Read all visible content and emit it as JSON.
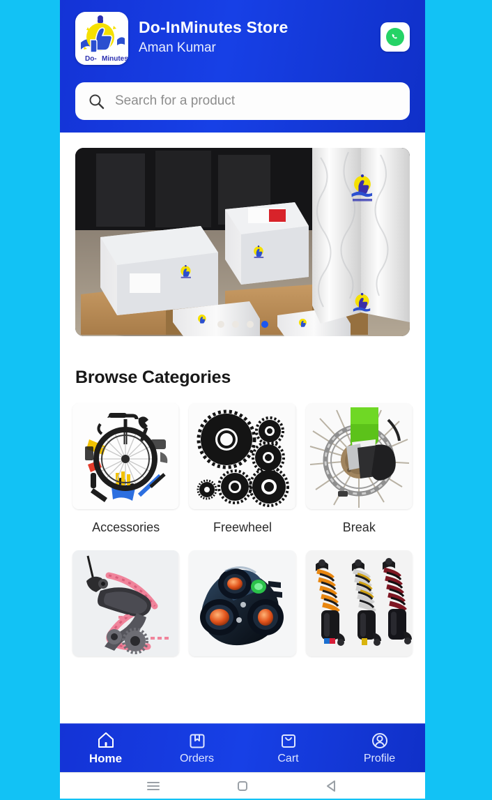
{
  "theme": {
    "outer_bg": "#12c2f5",
    "header_blue": "#1740e6",
    "accent_blue": "#1a56f0",
    "whatsapp_green": "#25D366",
    "logo_yellow": "#f5e000",
    "logo_blue": "#2b2fb0"
  },
  "header": {
    "logo": {
      "icon": "do-inminutes-logo",
      "caption_left": "Do-",
      "caption_right": "Minutes"
    },
    "store_name": "Do-InMinutes Store",
    "owner_name": "Aman Kumar",
    "whatsapp_icon": "whatsapp-icon"
  },
  "search": {
    "icon": "search-icon",
    "placeholder": "Search for a product",
    "value": ""
  },
  "carousel": {
    "alt": "Packed shipment boxes and wrapped bundles with Do-InMinutes logo stickers",
    "slide_count": 4,
    "active_index": 3
  },
  "sections": {
    "browse_categories_title": "Browse Categories"
  },
  "categories": [
    {
      "label": "Accessories",
      "image": "bicycle-wheel-with-tools-image"
    },
    {
      "label": "Freewheel",
      "image": "cassette-sprockets-image"
    },
    {
      "label": "Break",
      "image": "disc-brake-rotor-image"
    },
    {
      "label": "",
      "image": "rear-derailleur-with-chain-image"
    },
    {
      "label": "",
      "image": "hub-assembly-image"
    },
    {
      "label": "",
      "image": "suspension-shock-absorbers-image"
    }
  ],
  "bottom_nav": [
    {
      "label": "Home",
      "icon": "home-icon",
      "active": true
    },
    {
      "label": "Orders",
      "icon": "package-icon",
      "active": false
    },
    {
      "label": "Cart",
      "icon": "bag-icon",
      "active": false
    },
    {
      "label": "Profile",
      "icon": "person-icon",
      "active": false
    }
  ],
  "system_nav": [
    {
      "icon": "recents-menu-icon"
    },
    {
      "icon": "home-square-icon"
    },
    {
      "icon": "back-triangle-icon"
    }
  ]
}
